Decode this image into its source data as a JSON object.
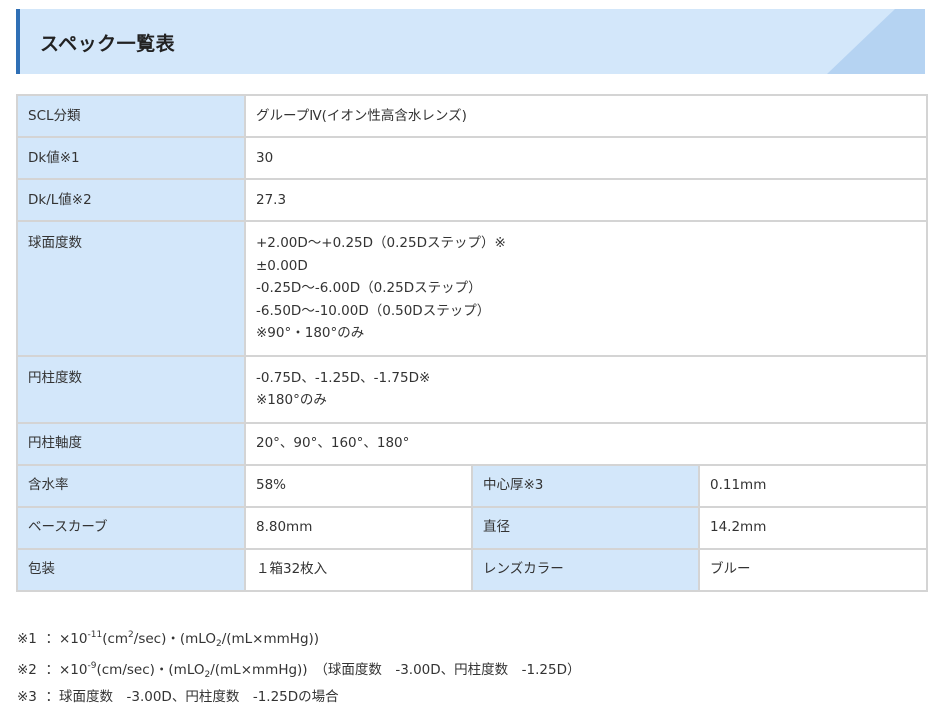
{
  "title": "スペック一覧表",
  "rows": {
    "scl": {
      "label": "SCL分類",
      "value": "グループⅣ(イオン性高含水レンズ)"
    },
    "dk": {
      "label": "Dk値※1",
      "value": "30"
    },
    "dkl": {
      "label": "Dk/L値※2",
      "value": "27.3"
    },
    "sphere": {
      "label": "球面度数",
      "lines": [
        "+2.00D～+0.25D（0.25Dステップ）※",
        "±0.00D",
        "-0.25D～-6.00D（0.25Dステップ）",
        "-6.50D～-10.00D（0.50Dステップ）",
        "※90°・180°のみ"
      ]
    },
    "cyl": {
      "label": "円柱度数",
      "lines": [
        "-0.75D、-1.25D、-1.75D※",
        "※180°のみ"
      ]
    },
    "axis": {
      "label": "円柱軸度",
      "value": "20°、90°、160°、180°"
    },
    "water": {
      "label": "含水率",
      "value": "58%"
    },
    "center": {
      "label": "中心厚※3",
      "value": "0.11mm"
    },
    "bc": {
      "label": "ベースカーブ",
      "value": "8.80mm"
    },
    "diameter": {
      "label": "直径",
      "value": "14.2mm"
    },
    "package": {
      "label": "包装",
      "value": "１箱32枚入"
    },
    "color": {
      "label": "レンズカラー",
      "value": "ブルー"
    }
  },
  "notes": {
    "n1": {
      "mark": "※1",
      "a": "：×10",
      "exp": "-11",
      "b": "(cm",
      "sup2": "2",
      "c": "/sec)・(mLO",
      "sub2": "2",
      "d": "/(mL×mmHg))"
    },
    "n2": {
      "mark": "※2",
      "a": "：×10",
      "exp": "-9",
      "b": "(cm/sec)・(mLO",
      "sub2": "2",
      "c": "/(mL×mmHg))　（球面度数　-3.00D、円柱度数　-1.25D）"
    },
    "n3": {
      "mark": "※3",
      "text": "：球面度数　-3.00D、円柱度数　-1.25Dの場合"
    }
  },
  "colors": {
    "label_bg": "#d3e7fa",
    "accent": "#2f6fb5",
    "border": "#d4d4d4"
  }
}
